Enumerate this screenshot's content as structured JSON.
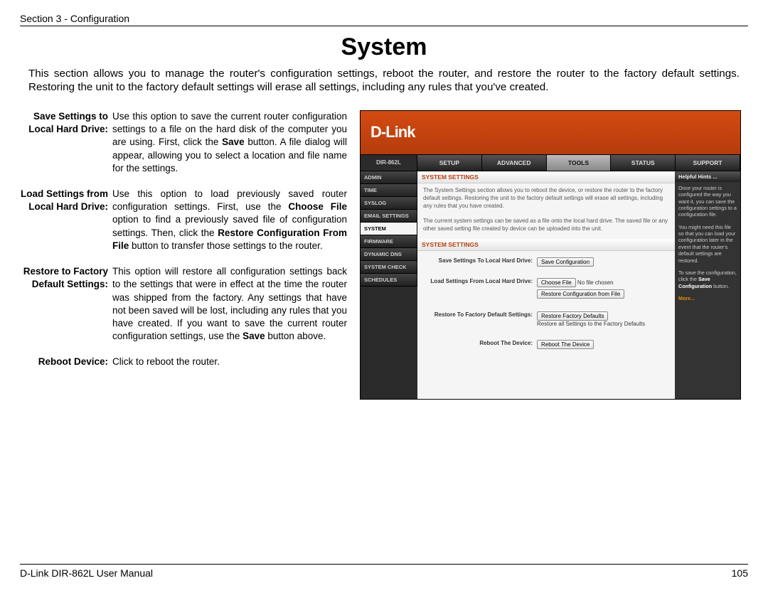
{
  "header": {
    "section": "Section 3 - Configuration"
  },
  "title": "System",
  "intro": "This section allows you to manage the router's configuration settings, reboot the router, and restore the router to the factory default settings. Restoring the unit to the factory default settings will erase all settings, including any rules that you've created.",
  "defs": {
    "save": {
      "label": "Save Settings to Local Hard Drive:",
      "p1": "Use this option to save the current router configuration settings to a file on the hard disk of the computer you are using. First, click the ",
      "b1": "Save",
      "p2": " button. A file dialog will appear, allowing you to select a location and file name for the settings."
    },
    "load": {
      "label": "Load Settings from Local Hard Drive:",
      "p1": "Use this option to load previously saved router configuration settings. First, use the ",
      "b1": "Choose File",
      "p2": " option to find a previously saved file of configuration settings. Then, click the ",
      "b2": "Restore Configuration From File",
      "p3": " button to transfer those settings to the router."
    },
    "restore": {
      "label": "Restore to Factory Default Settings:",
      "p1": "This option will restore all configuration settings back to the settings that were in effect at the time the router was shipped from the factory. Any settings that have not been saved will be lost, including any rules that you have created. If you want to save the current router configuration settings, use the ",
      "b1": "Save",
      "p2": " button above."
    },
    "reboot": {
      "label": "Reboot Device:",
      "body": "Click to reboot the router."
    }
  },
  "router": {
    "logo": "D-Link",
    "model": "DIR-862L",
    "tabs": [
      "SETUP",
      "ADVANCED",
      "TOOLS",
      "STATUS",
      "SUPPORT"
    ],
    "active_tab": "TOOLS",
    "sidebar": [
      "ADMIN",
      "TIME",
      "SYSLOG",
      "EMAIL SETTINGS",
      "SYSTEM",
      "FIRMWARE",
      "DYNAMIC DNS",
      "SYSTEM CHECK",
      "SCHEDULES"
    ],
    "sidebar_selected": "SYSTEM",
    "panel1_title": "SYSTEM SETTINGS",
    "panel1_desc": "The System Settings section allows you to reboot the device, or restore the router to the factory default settings. Restoring the unit to the factory default settings will erase all settings, including any rules that you have created.",
    "panel1_desc2": "The current system settings can be saved as a file onto the local hard drive. The saved file or any other saved setting file created by device can be uploaded into the unit.",
    "panel2_title": "SYSTEM SETTINGS",
    "rows": {
      "save_label": "Save Settings To Local Hard Drive:",
      "save_btn": "Save Configuration",
      "load_label": "Load Settings From Local Hard Drive:",
      "choose_btn": "Choose File",
      "choose_txt": "No file chosen",
      "restore_file_btn": "Restore Configuration from File",
      "factory_label": "Restore To Factory Default Settings:",
      "factory_btn": "Restore Factory Defaults",
      "factory_txt": "Restore all Settings to the Factory Defaults",
      "reboot_label": "Reboot The Device:",
      "reboot_btn": "Reboot The Device"
    },
    "hints": {
      "title": "Helpful Hints ...",
      "p1": "Once your router is configured the way you want it, you can save the configuration settings to a configuration file.",
      "p2": "You might need this file so that you can load your configuration later in the event that the router's default settings are restored.",
      "p3a": "To save the configuration, click the ",
      "p3b": "Save Configuration",
      "p3c": " button.",
      "more": "More..."
    }
  },
  "footer": {
    "left": "D-Link DIR-862L User Manual",
    "right": "105"
  }
}
